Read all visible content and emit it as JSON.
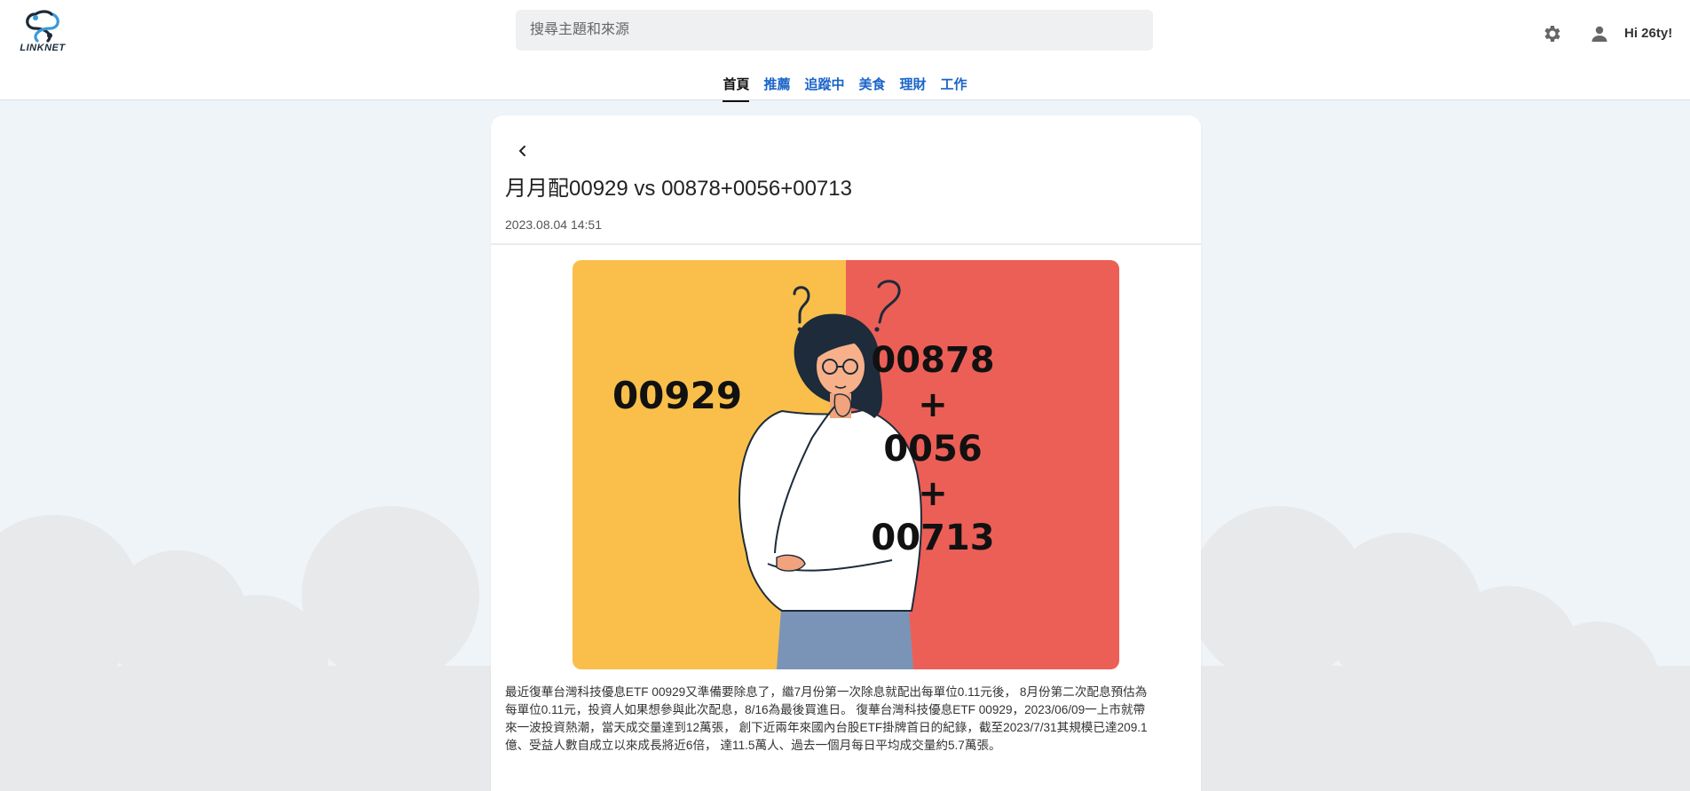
{
  "header": {
    "logo_text": "LINKNET",
    "search_placeholder": "搜尋主題和來源",
    "greeting": "Hi 26ty!",
    "icons": [
      "gear-icon",
      "user-icon"
    ]
  },
  "tabs": [
    {
      "label": "首頁",
      "active": true
    },
    {
      "label": "推薦",
      "active": false
    },
    {
      "label": "追蹤中",
      "active": false
    },
    {
      "label": "美食",
      "active": false
    },
    {
      "label": "理財",
      "active": false
    },
    {
      "label": "工作",
      "active": false
    }
  ],
  "article": {
    "title": "月月配00929 vs 00878+0056+00713",
    "date": "2023.08.04 14:51",
    "hero": {
      "left_label": "00929",
      "right_lines": [
        "00878",
        "+",
        "0056",
        "+",
        "00713"
      ],
      "colors": {
        "left": "#f9bf4a",
        "right": "#ec5f57"
      }
    },
    "body": [
      "最近復華台灣科技優息ETF 00929又準備要除息了，繼7月份第一次除息就配出每單位0.11元後， 8月份第二次配息預估為",
      "每單位0.11元，投資人如果想參與此次配息，8/16為最後買進日。 復華台灣科技優息ETF 00929，2023/06/09一上市就帶",
      "來一波投資熱潮，當天成交量達到12萬張， 創下近兩年來國內台股ETF掛牌首日的紀錄，截至2023/7/31其規模已達209.1",
      "億、受益人數自成立以來成長將近6倍， 達11.5萬人、過去一個月每日平均成交量約5.7萬張。"
    ]
  }
}
